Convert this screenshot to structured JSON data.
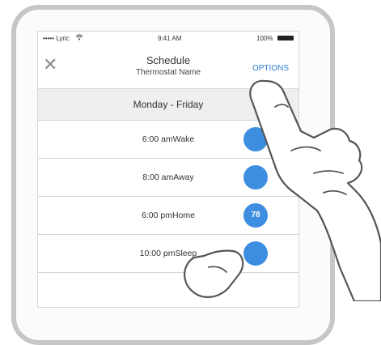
{
  "status_bar": {
    "carrier": "••••• Lyric",
    "time": "9:41 AM",
    "battery": "100%"
  },
  "header": {
    "title": "Schedule",
    "subtitle": "Thermostat Name",
    "options_label": "OPTIONS",
    "close_glyph": "✕"
  },
  "day_group": "Monday - Friday",
  "schedule": [
    {
      "label": "6:00 amWake",
      "setpoint": ""
    },
    {
      "label": "8:00 amAway",
      "setpoint": ""
    },
    {
      "label": "6:00 pmHome",
      "setpoint": "78"
    },
    {
      "label": "10:00 pmSleep",
      "setpoint": ""
    }
  ],
  "colors": {
    "accent": "#3d8ee0",
    "link": "#2a7fd0"
  },
  "icons": [
    "close-icon",
    "wifi-icon",
    "battery-icon",
    "pointing-hand-icon"
  ]
}
